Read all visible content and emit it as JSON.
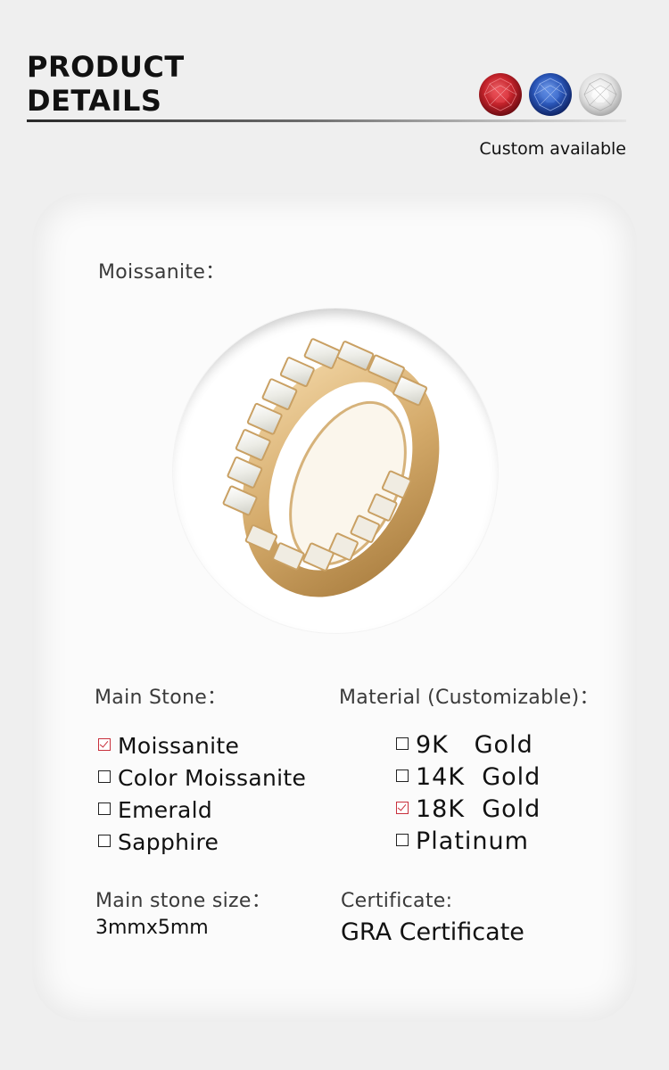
{
  "header": {
    "title_line1": "PRODUCT",
    "title_line2": "DETAILS",
    "custom_label": "Custom available",
    "gems": [
      {
        "name": "red-gem-icon",
        "color": "#c4232b"
      },
      {
        "name": "blue-gem-icon",
        "color": "#2a56b8"
      },
      {
        "name": "white-gem-icon",
        "color": "#e6e6e6"
      }
    ]
  },
  "card": {
    "stone_label": "Moissanite：",
    "main_stone": {
      "label": "Main Stone：",
      "options": [
        {
          "text": "Moissanite",
          "checked": true
        },
        {
          "text": "Color Moissanite",
          "checked": false
        },
        {
          "text": "Emerald",
          "checked": false
        },
        {
          "text": "Sapphire",
          "checked": false
        }
      ]
    },
    "material": {
      "label": "Material (Customizable)：",
      "options": [
        {
          "text": "9K   Gold",
          "checked": false
        },
        {
          "text": "14K  Gold",
          "checked": false
        },
        {
          "text": "18K  Gold",
          "checked": true
        },
        {
          "text": "Platinum",
          "checked": false
        }
      ]
    },
    "size": {
      "label": "Main stone size：",
      "value": "3mmx5mm"
    },
    "certificate": {
      "label": "Certificate:",
      "value": "GRA Certificate"
    }
  }
}
